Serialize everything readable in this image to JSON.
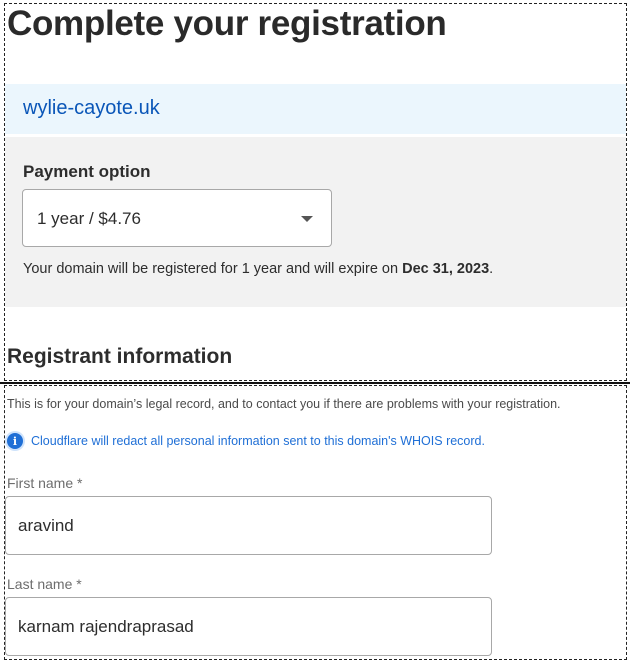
{
  "header": {
    "title": "Complete your registration"
  },
  "domain": {
    "name": "wylie-cayote.uk"
  },
  "payment": {
    "label": "Payment option",
    "selected": "1 year / $4.76",
    "note_prefix": "Your domain will be registered for 1 year and will expire on ",
    "expiry_date": "Dec 31, 2023",
    "note_suffix": "."
  },
  "registrant": {
    "title": "Registrant information",
    "description": "This is for your domain’s legal record, and to contact you if there are problems with your registration.",
    "whois_notice": "Cloudflare will redact all personal information sent to this domain's WHOIS record.",
    "info_icon_glyph": "i",
    "first_name": {
      "label": "First name *",
      "value": "aravind"
    },
    "last_name": {
      "label": "Last name *",
      "value": "karnam rajendraprasad"
    }
  },
  "colors": {
    "link_blue": "#0a56b8",
    "info_blue": "#1f6fd6",
    "banner_bg": "#ebf6fd",
    "panel_bg": "#f2f2f2"
  },
  "icons": {
    "dropdown": "chevron-down-icon",
    "info": "info-icon"
  }
}
